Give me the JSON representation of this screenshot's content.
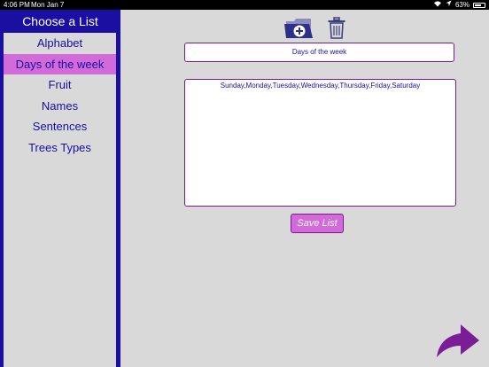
{
  "status_bar": {
    "time": "4:06 PM",
    "date": "Mon Jan 7",
    "battery": "63%"
  },
  "sidebar": {
    "title": "Choose a List",
    "items": [
      {
        "label": "Alphabet",
        "selected": false
      },
      {
        "label": "Days of the week",
        "selected": true
      },
      {
        "label": "Fruit",
        "selected": false
      },
      {
        "label": "Names",
        "selected": false
      },
      {
        "label": "Sentences",
        "selected": false
      },
      {
        "label": "Trees Types",
        "selected": false
      }
    ]
  },
  "editor": {
    "list_name": "Days of the week",
    "list_items": "Sunday,Monday,Tuesday,Wednesday,Thursday,Friday,Saturday",
    "save_label": "Save List"
  },
  "icons": {
    "new_list": "folder-plus-icon",
    "delete": "trash-icon",
    "next": "curved-arrow-icon"
  },
  "colors": {
    "sidebar_bg": "#1a0fa0",
    "selected_bg": "#d36ad9",
    "accent_purple": "#7a1a86",
    "background": "#d9d9d9"
  }
}
